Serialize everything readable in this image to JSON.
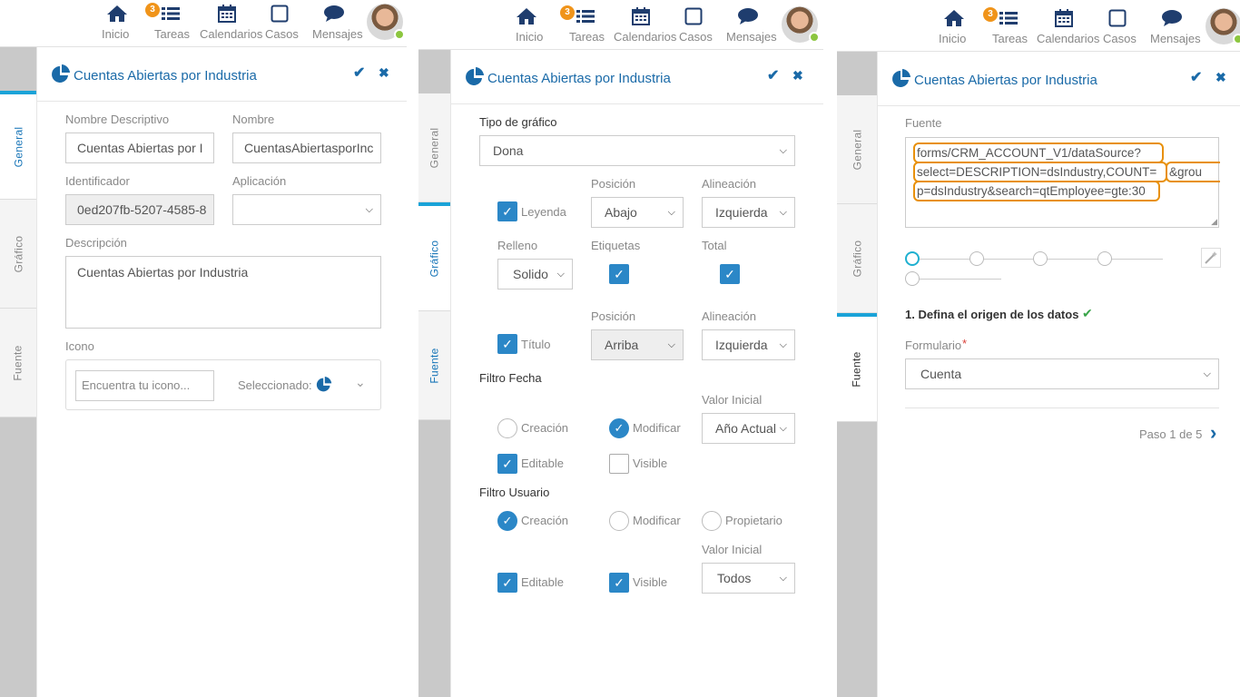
{
  "nav": {
    "inicio": "Inicio",
    "tareas": "Tareas",
    "tareas_badge": "3",
    "calendarios": "Calendarios",
    "casos": "Casos",
    "mensajes": "Mensajes"
  },
  "tabs": {
    "general": "General",
    "grafico": "Gráfico",
    "fuente": "Fuente"
  },
  "dialog": {
    "title": "Cuentas Abiertas por Industria",
    "confirm": "✔",
    "close": "✖"
  },
  "p1": {
    "nombre_descriptivo_label": "Nombre Descriptivo",
    "nombre_descriptivo_value": "Cuentas Abiertas por I",
    "nombre_label": "Nombre",
    "nombre_value": "CuentasAbiertasporInc",
    "identificador_label": "Identificador",
    "identificador_value": "0ed207fb-5207-4585-8",
    "aplicacion_label": "Aplicación",
    "aplicacion_value": "",
    "descripcion_label": "Descripción",
    "descripcion_value": "Cuentas Abiertas por Industria",
    "icono_label": "Icono",
    "icono_placeholder": "Encuentra tu icono...",
    "seleccionado_label": "Seleccionado:"
  },
  "p2": {
    "tipo_label": "Tipo de gráfico",
    "tipo_value": "Dona",
    "posicion_label": "Posición",
    "alineacion_label": "Alineación",
    "leyenda": "Leyenda",
    "leyenda_pos": "Abajo",
    "leyenda_alin": "Izquierda",
    "relleno_label": "Relleno",
    "relleno_value": "Solido",
    "etiquetas_label": "Etiquetas",
    "total_label": "Total",
    "posicion2_label": "Posición",
    "alineacion2_label": "Alineación",
    "titulo": "Título",
    "titulo_pos": "Arriba",
    "titulo_alin": "Izquierda",
    "filtro_fecha": "Filtro Fecha",
    "valor_inicial_label": "Valor Inicial",
    "creacion": "Creación",
    "modificar": "Modificar",
    "fecha_valor": "Año Actual",
    "editable": "Editable",
    "visible": "Visible",
    "filtro_usuario": "Filtro Usuario",
    "u_creacion": "Creación",
    "u_modificar": "Modificar",
    "u_propietario": "Propietario",
    "valor_inicial2_label": "Valor Inicial",
    "u_editable": "Editable",
    "u_visible": "Visible",
    "usuario_valor": "Todos"
  },
  "p3": {
    "fuente_label": "Fuente",
    "fuente_line1": "forms/CRM_ACCOUNT_V1/dataSource?",
    "fuente_line2": "select=DESCRIPTION=dsIndustry,COUNT=",
    "fuente_line2b": "&grou",
    "fuente_line3": "p=dsIndustry&search=qtEmployee=gte:30",
    "step_title": "1. Defina el origen de los datos",
    "formulario_label": "Formulario",
    "required": "*",
    "formulario_value": "Cuenta",
    "paso": "Paso 1 de 5",
    "next": "›"
  }
}
